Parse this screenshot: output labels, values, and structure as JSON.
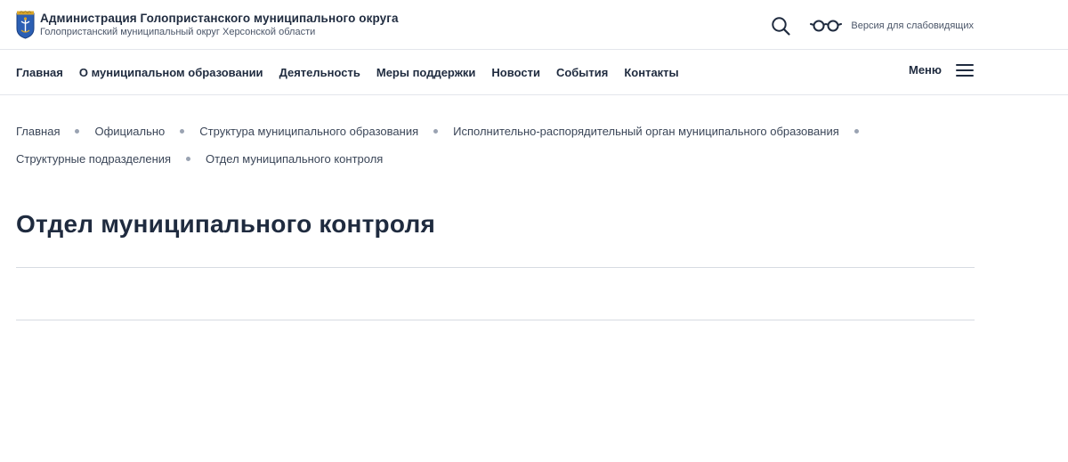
{
  "header": {
    "title": "Администрация Голопристанского муниципального округа",
    "subtitle": "Голопристанский муниципальный округ Херсонской области",
    "accessibility_label": "Версия для слабовидящих",
    "emblem_icon": "coat-of-arms-icon",
    "search_icon": "search-icon",
    "glasses_icon": "glasses-icon"
  },
  "nav": {
    "items": [
      {
        "label": "Главная"
      },
      {
        "label": "О муниципальном образовании"
      },
      {
        "label": "Деятельность"
      },
      {
        "label": "Меры поддержки"
      },
      {
        "label": "Новости"
      },
      {
        "label": "События"
      },
      {
        "label": "Контакты"
      }
    ],
    "menu_label": "Меню",
    "menu_icon": "hamburger-icon"
  },
  "breadcrumb": [
    {
      "label": "Главная"
    },
    {
      "label": "Официально"
    },
    {
      "label": "Структура муниципального образования"
    },
    {
      "label": "Исполнительно-распорядительный орган муниципального образования"
    },
    {
      "label": "Структурные подразделения"
    },
    {
      "label": "Отдел муниципального контроля"
    }
  ],
  "page": {
    "title": "Отдел муниципального контроля"
  },
  "colors": {
    "text_primary": "#1f2b3f",
    "text_secondary": "#4a5568",
    "divider": "#d7dbe2",
    "breadcrumb_dot": "#9aa3b2",
    "emblem_blue": "#2b5fb4",
    "emblem_gold": "#d9a62b"
  }
}
